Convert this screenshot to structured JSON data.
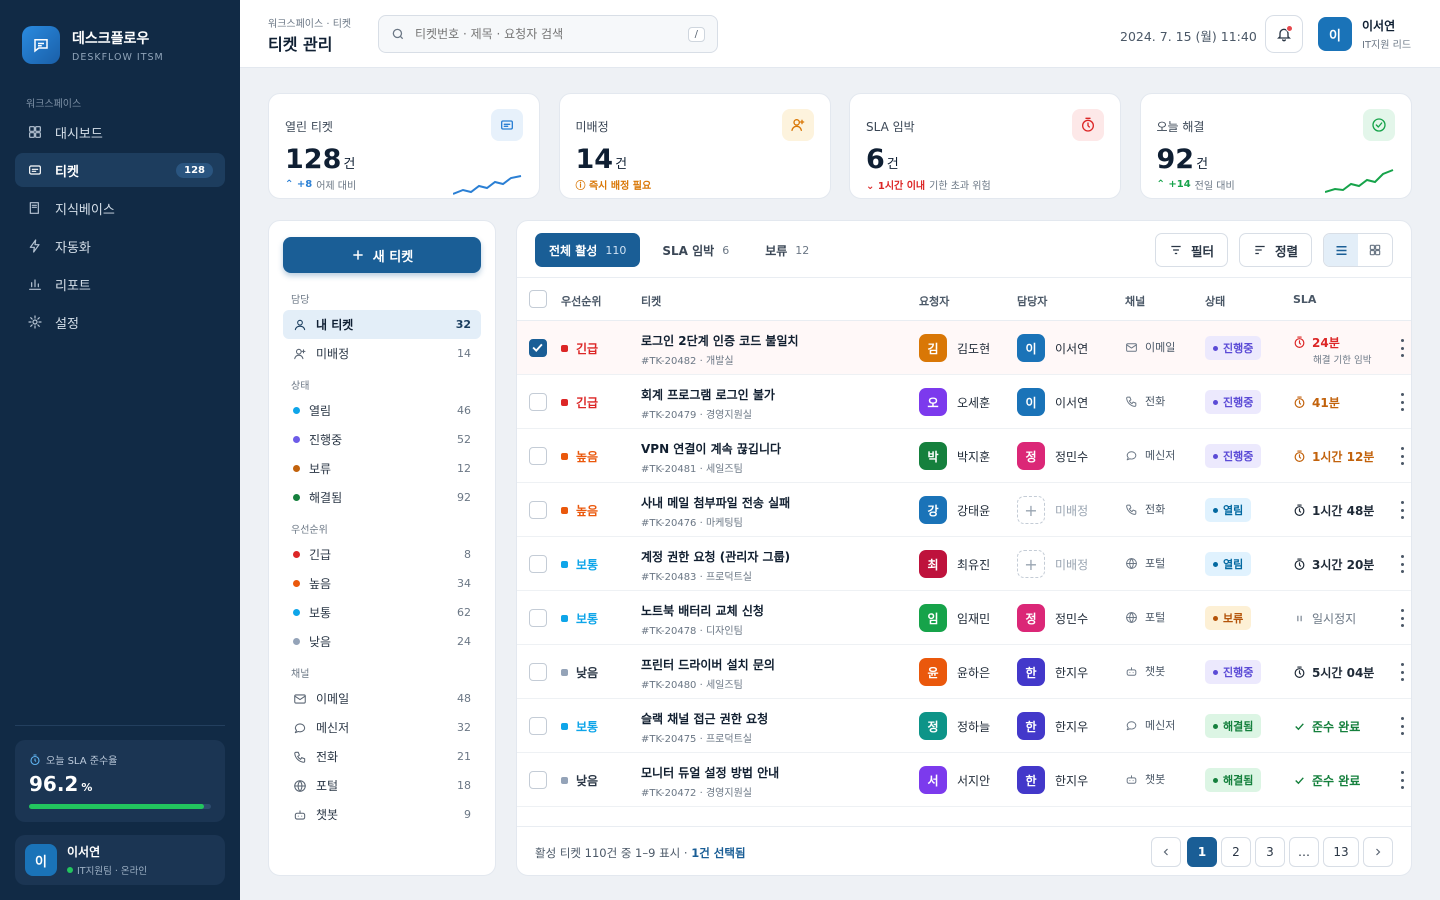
{
  "brand": {
    "name": "데스크플로우",
    "sub": "DESKFLOW ITSM"
  },
  "sidebar": {
    "section": "워크스페이스",
    "items": [
      {
        "label": "대시보드",
        "icon": "grid-icon"
      },
      {
        "label": "티켓",
        "icon": "ticket-icon",
        "count": "128",
        "active": true
      },
      {
        "label": "지식베이스",
        "icon": "book-icon"
      },
      {
        "label": "자동화",
        "icon": "bolt-icon"
      },
      {
        "label": "리포트",
        "icon": "chart-icon"
      },
      {
        "label": "설정",
        "icon": "gear-icon"
      }
    ],
    "sla": {
      "label": "오늘 SLA 준수율",
      "value": "96.2",
      "unit": "%",
      "progress": 0.962
    },
    "user": {
      "initial": "이",
      "name": "이서연",
      "status": "IT지원팀 · 온라인"
    }
  },
  "header": {
    "breadcrumb": "워크스페이스 · 티켓",
    "title": "티켓 관리",
    "search_placeholder": "티켓번호 · 제목 · 요청자 검색",
    "search_shortcut": "/",
    "datetime": "2024. 7. 15 (월) 11:40",
    "user": {
      "initial": "이",
      "name": "이서연",
      "role": "IT지원 리드"
    }
  },
  "kpis": [
    {
      "label": "열린 티켓",
      "value": "128",
      "unit": "건",
      "delta": "+8",
      "note": "어제 대비",
      "icon": "ticket-icon",
      "color": "#2a7fd4"
    },
    {
      "label": "미배정",
      "value": "14",
      "unit": "건",
      "delta": "",
      "note": "즉시 배정 필요",
      "icon": "user-plus-icon",
      "color": "#d97706"
    },
    {
      "label": "SLA 임박",
      "value": "6",
      "unit": "건",
      "delta": "1시간 이내",
      "note": "기한 초과 위험",
      "icon": "timer-icon",
      "color": "#dc2626"
    },
    {
      "label": "오늘 해결",
      "value": "92",
      "unit": "건",
      "delta": "+14",
      "note": "전일 대비",
      "icon": "check-circle-icon",
      "color": "#16a34a"
    }
  ],
  "filters": {
    "new_button": "새 티켓",
    "sections": [
      {
        "title": "담당",
        "items": [
          {
            "label": "내 티켓",
            "count": "32",
            "icon": "user-icon",
            "active": true
          },
          {
            "label": "미배정",
            "count": "14",
            "icon": "user-plus-icon"
          }
        ]
      },
      {
        "title": "상태",
        "items": [
          {
            "label": "열림",
            "count": "46",
            "color": "#0ea5e9"
          },
          {
            "label": "진행중",
            "count": "52",
            "color": "#6d5ce8"
          },
          {
            "label": "보류",
            "count": "12",
            "color": "#c2620c"
          },
          {
            "label": "해결됨",
            "count": "92",
            "color": "#15803d"
          }
        ]
      },
      {
        "title": "우선순위",
        "items": [
          {
            "label": "긴급",
            "count": "8",
            "color": "#dc2626"
          },
          {
            "label": "높음",
            "count": "34",
            "color": "#ea580c"
          },
          {
            "label": "보통",
            "count": "62",
            "color": "#0ea5e9"
          },
          {
            "label": "낮음",
            "count": "24",
            "color": "#94a3b8"
          }
        ]
      },
      {
        "title": "채널",
        "items": [
          {
            "label": "이메일",
            "count": "48",
            "icon": "mail-icon"
          },
          {
            "label": "메신저",
            "count": "32",
            "icon": "chat-icon"
          },
          {
            "label": "전화",
            "count": "21",
            "icon": "phone-icon"
          },
          {
            "label": "포털",
            "count": "18",
            "icon": "globe-icon"
          },
          {
            "label": "챗봇",
            "count": "9",
            "icon": "bot-icon"
          }
        ]
      }
    ]
  },
  "table": {
    "tabs": [
      {
        "label": "전체 활성",
        "count": "110",
        "active": true
      },
      {
        "label": "SLA 임박",
        "count": "6"
      },
      {
        "label": "보류",
        "count": "12"
      }
    ],
    "filter_label": "필터",
    "sort_label": "정렬",
    "columns": [
      "우선순위",
      "티켓",
      "요청자",
      "담당자",
      "채널",
      "상태",
      "SLA"
    ],
    "rows": [
      {
        "selected": true,
        "priority": "긴급",
        "pcolor": "#dc2626",
        "title": "로그인 2단계 인증 코드 불일치",
        "id": "#TK-20482",
        "dept": "개발실",
        "req": "김도현",
        "reqi": "김",
        "reqc": "#d97706",
        "asg": "이서연",
        "asgi": "이",
        "asgc": "#1a73b8",
        "channel": "이메일",
        "chicon": "mail-icon",
        "status": "진행중",
        "stype": "prog",
        "sla": "24분",
        "slanote": "해결 기한 임박",
        "slatype": "red"
      },
      {
        "priority": "긴급",
        "pcolor": "#dc2626",
        "title": "회계 프로그램 로그인 불가",
        "id": "#TK-20479",
        "dept": "경영지원실",
        "req": "오세훈",
        "reqi": "오",
        "reqc": "#7c3aed",
        "asg": "이서연",
        "asgi": "이",
        "asgc": "#1a73b8",
        "channel": "전화",
        "chicon": "phone-icon",
        "status": "진행중",
        "stype": "prog",
        "sla": "41분",
        "slanote": "",
        "slatype": "orange"
      },
      {
        "priority": "높음",
        "pcolor": "#ea580c",
        "title": "VPN 연결이 계속 끊깁니다",
        "id": "#TK-20481",
        "dept": "세일즈팀",
        "req": "박지훈",
        "reqi": "박",
        "reqc": "#15803d",
        "asg": "정민수",
        "asgi": "정",
        "asgc": "#db2777",
        "channel": "메신저",
        "chicon": "chat-icon",
        "status": "진행중",
        "stype": "prog",
        "sla": "1시간 12분",
        "slanote": "",
        "slatype": "orange"
      },
      {
        "priority": "높음",
        "pcolor": "#ea580c",
        "title": "사내 메일 첨부파일 전송 실패",
        "id": "#TK-20476",
        "dept": "마케팅팀",
        "req": "강태윤",
        "reqi": "강",
        "reqc": "#1a73b8",
        "asg": "미배정",
        "asgi": "",
        "asgc": "",
        "channel": "전화",
        "chicon": "phone-icon",
        "status": "열림",
        "stype": "open",
        "sla": "1시간 48분",
        "slanote": "",
        "slatype": "dark"
      },
      {
        "priority": "보통",
        "pcolor": "#0ea5e9",
        "title": "계정 권한 요청 (관리자 그룹)",
        "id": "#TK-20483",
        "dept": "프로덕트실",
        "req": "최유진",
        "reqi": "최",
        "reqc": "#be123c",
        "asg": "미배정",
        "asgi": "",
        "asgc": "",
        "channel": "포털",
        "chicon": "globe-icon",
        "status": "열림",
        "stype": "open",
        "sla": "3시간 20분",
        "slanote": "",
        "slatype": "dark"
      },
      {
        "priority": "보통",
        "pcolor": "#0ea5e9",
        "title": "노트북 배터리 교체 신청",
        "id": "#TK-20478",
        "dept": "디자인팀",
        "req": "임재민",
        "reqi": "임",
        "reqc": "#16a34a",
        "asg": "정민수",
        "asgi": "정",
        "asgc": "#db2777",
        "channel": "포털",
        "chicon": "globe-icon",
        "status": "보류",
        "stype": "hold",
        "sla": "일시정지",
        "slanote": "",
        "slatype": "paused"
      },
      {
        "priority": "낮음",
        "pcolor": "#94a3b8",
        "title": "프린터 드라이버 설치 문의",
        "id": "#TK-20480",
        "dept": "세일즈팀",
        "req": "윤하은",
        "reqi": "윤",
        "reqc": "#ea580c",
        "asg": "한지우",
        "asgi": "한",
        "asgc": "#4338ca",
        "channel": "챗봇",
        "chicon": "bot-icon",
        "status": "진행중",
        "stype": "prog",
        "sla": "5시간 04분",
        "slanote": "",
        "slatype": "dark"
      },
      {
        "priority": "보통",
        "pcolor": "#0ea5e9",
        "title": "슬랙 채널 접근 권한 요청",
        "id": "#TK-20475",
        "dept": "프로덕트실",
        "req": "정하늘",
        "reqi": "정",
        "reqc": "#0d9488",
        "asg": "한지우",
        "asgi": "한",
        "asgc": "#4338ca",
        "channel": "메신저",
        "chicon": "chat-icon",
        "status": "해결됨",
        "stype": "done",
        "sla": "준수 완료",
        "slanote": "",
        "slatype": "green"
      },
      {
        "priority": "낮음",
        "pcolor": "#94a3b8",
        "title": "모니터 듀얼 설정 방법 안내",
        "id": "#TK-20472",
        "dept": "경영지원실",
        "req": "서지안",
        "reqi": "서",
        "reqc": "#7c3aed",
        "asg": "한지우",
        "asgi": "한",
        "asgc": "#4338ca",
        "channel": "챗봇",
        "chicon": "bot-icon",
        "status": "해결됨",
        "stype": "done",
        "sla": "준수 완료",
        "slanote": "",
        "slatype": "green"
      }
    ],
    "footer": {
      "summary": "활성 티켓 110건 중 1–9 표시 · ",
      "selected": "1건 선택됨",
      "pages": [
        "1",
        "2",
        "3",
        "…",
        "13"
      ],
      "current": "1"
    }
  }
}
